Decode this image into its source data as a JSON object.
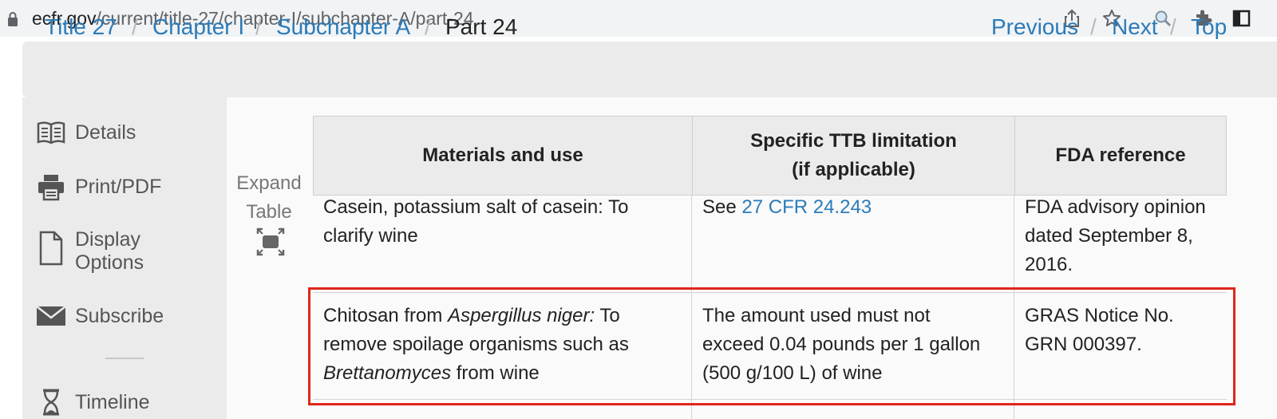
{
  "browser": {
    "url_domain": "ecfr.gov",
    "url_path": "/current/title-27/chapter-I/subchapter-A/part-24",
    "icons": [
      "lock-icon",
      "share-icon",
      "star-icon",
      "zoom-icon",
      "extensions-icon",
      "sidepanel-icon"
    ]
  },
  "breadcrumb": {
    "items": [
      {
        "label": "Title 27"
      },
      {
        "label": "Chapter I"
      },
      {
        "label": "Subchapter A"
      },
      {
        "label": "Part 24"
      }
    ],
    "separator": "/",
    "nav": [
      {
        "label": "Previous"
      },
      {
        "label": "Next"
      },
      {
        "label": "Top"
      }
    ]
  },
  "sidebar": {
    "items": [
      {
        "label": "Details",
        "icon": "book-icon"
      },
      {
        "label": "Print/PDF",
        "icon": "printer-icon"
      },
      {
        "label": "Display",
        "label2": "Options",
        "icon": "document-icon"
      },
      {
        "label": "Subscribe",
        "icon": "envelope-icon"
      },
      {
        "label": "Timeline",
        "icon": "hourglass-icon"
      }
    ]
  },
  "expand_table": {
    "line1": "Expand",
    "line2": "Table",
    "icon": "expand-icon"
  },
  "table": {
    "headers": [
      "Materials and use",
      "Specific TTB limitation",
      "(if applicable)",
      "FDA reference"
    ],
    "rows": [
      {
        "material": [
          "Casein, potassium salt of casein: To",
          "clarify wine"
        ],
        "limitation_prefix": "See ",
        "limitation_link": "27 CFR 24.243",
        "fda": [
          "FDA advisory opinion",
          "dated September 8,",
          "2016."
        ]
      },
      {
        "material_a": "Chitosan from ",
        "material_italic": "Aspergillus niger:",
        "material_b": " To",
        "material_line2": "remove spoilage organisms such as",
        "material_italic2": "Brettanomyces",
        "material_line3": " from wine",
        "limitation": [
          "The amount used must not",
          "exceed 0.04 pounds per 1 gallon",
          "(500 g/100 L) of wine"
        ],
        "fda": [
          "GRAS Notice No.",
          "GRN 000397."
        ]
      }
    ]
  },
  "colors": {
    "link": "#2b7bb9",
    "highlight": "#e0261b",
    "sidebar_bg": "#ebebeb"
  }
}
